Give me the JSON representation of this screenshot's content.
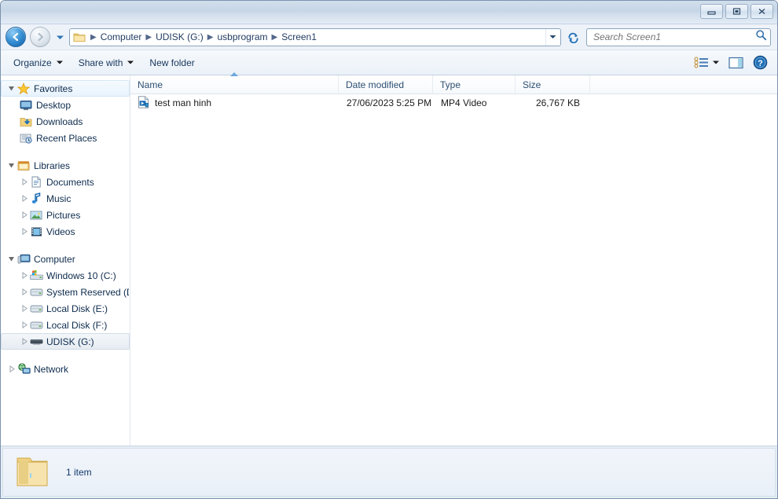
{
  "window": {
    "controls": [
      {
        "name": "minimize-button",
        "label": "Minimize"
      },
      {
        "name": "maximize-button",
        "label": "Maximize"
      },
      {
        "name": "close-button",
        "label": "Close"
      }
    ]
  },
  "navigation": {
    "back_label": "Back",
    "forward_label": "Forward",
    "history_label": "Recent pages",
    "refresh_label": "Refresh",
    "address_dropdown_label": "Previous locations"
  },
  "breadcrumbs": [
    {
      "label": "Computer"
    },
    {
      "label": "UDISK (G:)"
    },
    {
      "label": "usbprogram"
    },
    {
      "label": "Screen1"
    }
  ],
  "search": {
    "placeholder": "Search Screen1",
    "value": "",
    "icon": "search-icon"
  },
  "toolbar": {
    "organize_label": "Organize",
    "share_label": "Share with",
    "newfolder_label": "New folder",
    "views_label": "Change your view",
    "preview_label": "Show the preview pane",
    "help_label": "Get help"
  },
  "sidebar": {
    "groups": [
      {
        "name": "favorites",
        "header": {
          "label": "Favorites",
          "icon": "star-icon",
          "expanded": true,
          "hovered": true
        },
        "items": [
          {
            "label": "Desktop",
            "icon": "desktop-icon",
            "expandable": false
          },
          {
            "label": "Downloads",
            "icon": "downloads-folder-icon",
            "expandable": false
          },
          {
            "label": "Recent Places",
            "icon": "recent-places-icon",
            "expandable": false
          }
        ]
      },
      {
        "name": "libraries",
        "header": {
          "label": "Libraries",
          "icon": "libraries-icon",
          "expanded": true,
          "hovered": false
        },
        "items": [
          {
            "label": "Documents",
            "icon": "document-icon",
            "expandable": true
          },
          {
            "label": "Music",
            "icon": "music-note-icon",
            "expandable": true
          },
          {
            "label": "Pictures",
            "icon": "picture-icon",
            "expandable": true
          },
          {
            "label": "Videos",
            "icon": "video-film-icon",
            "expandable": true
          }
        ]
      },
      {
        "name": "computer",
        "header": {
          "label": "Computer",
          "icon": "computer-icon",
          "expanded": true,
          "hovered": false
        },
        "items": [
          {
            "label": "Windows 10 (C:)",
            "icon": "system-drive-icon",
            "expandable": true
          },
          {
            "label": "System Reserved (D:",
            "icon": "drive-icon",
            "expandable": true
          },
          {
            "label": "Local Disk (E:)",
            "icon": "drive-icon",
            "expandable": true
          },
          {
            "label": "Local Disk (F:)",
            "icon": "drive-icon",
            "expandable": true
          },
          {
            "label": "UDISK (G:)",
            "icon": "usb-drive-icon",
            "expandable": true,
            "selected": true
          }
        ]
      },
      {
        "name": "network",
        "header": {
          "label": "Network",
          "icon": "network-icon",
          "expanded": false,
          "hovered": false
        },
        "items": []
      }
    ]
  },
  "filelist": {
    "columns": [
      {
        "key": "name",
        "label": "Name",
        "sorted": true
      },
      {
        "key": "date",
        "label": "Date modified",
        "sorted": false
      },
      {
        "key": "type",
        "label": "Type",
        "sorted": false
      },
      {
        "key": "size",
        "label": "Size",
        "sorted": false
      }
    ],
    "rows": [
      {
        "name": "test man hinh",
        "date": "27/06/2023 5:25 PM",
        "type": "MP4 Video",
        "size": "26,767 KB",
        "icon": "media-file-icon"
      }
    ]
  },
  "statusbar": {
    "item_count": "1 item",
    "icon": "folder-icon"
  },
  "colors": {
    "accent": "#1f3a5f",
    "titlebar": "#c6d6e7",
    "selection": "#e6ecf2",
    "link_text": "#17365d"
  }
}
